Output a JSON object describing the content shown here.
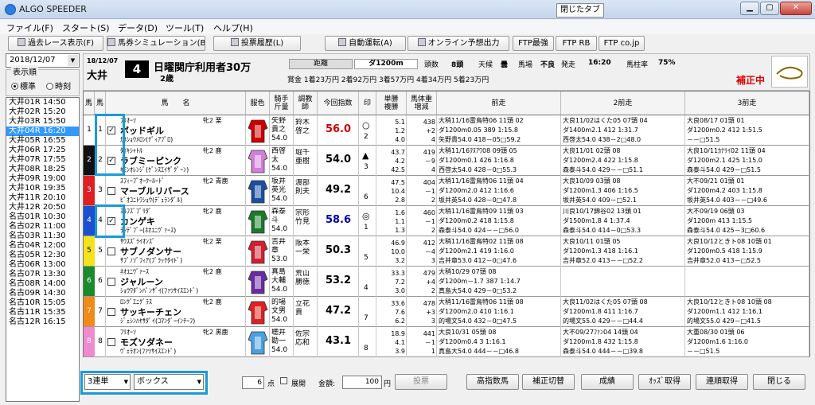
{
  "app_title": "ALGO SPEEDER",
  "closed_tab": "閉じたタブ",
  "menu": [
    "ファイル(F)",
    "スタート(S)",
    "データ(D)",
    "ツール(T)",
    "ヘルプ(H)"
  ],
  "toolbar": [
    "過去レース表示(F)",
    "馬券シミュレーション(B)",
    "投票履歴(L)",
    "自動運転(A)",
    "オンライン予想出力",
    "FTP最強",
    "FTP RB",
    "FTP co.jp"
  ],
  "date": "2018/12/07",
  "order": {
    "label": "表示順",
    "standard": "標準",
    "time": "時刻"
  },
  "races": [
    "大井01R 14:50",
    "大井02R 15:20",
    "大井03R 15:50",
    "大井04R 16:20",
    "大井05R 16:55",
    "大井06R 17:25",
    "大井07R 17:55",
    "大井08R 18:25",
    "大井09R 19:00",
    "大井10R 19:35",
    "大井11R 20:10",
    "大井12R 20:50",
    "名古01R 10:30",
    "名古02R 11:00",
    "名古03R 11:30",
    "名古04R 12:00",
    "名古05R 12:30",
    "名古06R 13:00",
    "名古07R 13:30",
    "名古08R 14:00",
    "名古09R 14:30",
    "名古10R 15:05",
    "名古11R 15:35",
    "名古12R 16:15"
  ],
  "header": {
    "date": "18/12/07",
    "venue": "大井",
    "race_no": "4",
    "race_name": "日曜関庁利用者30万",
    "age": "2歳",
    "prize": "賞金 1着23万円   2着92万円   3着57万円   4着34万円   5着23万円",
    "dist_label": "距離",
    "dist": "ダ1200m",
    "heads_label": "頭数",
    "heads": "8頭",
    "weather_label": "天候",
    "weather": "曇",
    "track_label": "馬場",
    "track": "不良",
    "post_label": "発走",
    "post": "16:20",
    "rate_label": "馬柱率",
    "rate": "75%",
    "corr": "補正中"
  },
  "columns": [
    "馬",
    "馬",
    "馬　　名",
    "服色",
    "騎手\n斤量",
    "調教\n師",
    "今回指数",
    "印",
    "単勝\n複勝",
    "馬体重\n増減",
    "前走",
    "2前走",
    "3前走"
  ],
  "horses": [
    {
      "frame": "1",
      "num": "1",
      "sire": "ﾌﾘｵｰｿ",
      "sex": "牝2 栗",
      "name": "ボッドギル",
      "dam": "ｶﾈｼｮｳﾒﾛﾝ(ﾃﾞｨｱﾌﾞﾛ)",
      "jockey": "矢野\n貴之\n54.0",
      "trainer": "鈴木\n啓之",
      "idx": "56.0",
      "idxcolor": "#cc0000",
      "mark1": "○",
      "mark2": "2",
      "win": "5.1\n1.2\n4.0",
      "wt": "438\n+2\n4",
      "p1": "大稍11/16雷鳥特06 11頭 02\nダ1200m0.05 389 1:15.8\n矢野貴54.0 418－05□59.2",
      "p2": "大良11/02はくた05 07頭 04\nダ1400m2.1 412 1:31.7\n西啓太54.0 438－2□48.0",
      "p3": "大良08/17 01頭 01\nダ1200m0.2 412 1:51.5\n－－□51.5"
    },
    {
      "frame": "2",
      "num": "2",
      "sire": "ﾀｲｷｼｬﾄﾙ",
      "sex": "牝2 鹿",
      "name": "ラブミーピンク",
      "dam": "ｷﾓﾝｵﾚﾝｼﾞ(ｹﾞﾝｽｴｲｻﾞｸﾞｰﾝ)",
      "jockey": "西啓\n太\n54.0",
      "trainer": "堀千\n亜樹",
      "idx": "54.0",
      "idxcolor": "#000",
      "mark1": "▲",
      "mark2": "3",
      "win": "43.7\n4.2\n42.5",
      "wt": "419\n－9\n4",
      "p1": "大稍11/16ｦﾇｱﾜ08 09頭 05\nダ1200m0.1 426 1:16.8\n西啓太54.0 428－0□55.3",
      "p2": "大良11/01 02頭 08\nダ1200m2.4 422 1:15.8\n森泰斗54.0 429－－□51.1",
      "p3": "大良10/11ｶﾅﾘｲ02 11頭 04\nダ1200m2.1 425 1:15.0\n森泰斗54.0 429－□51.5"
    },
    {
      "frame": "3",
      "num": "3",
      "sire": "ｽﾌｨｰﾌﾟｵｰｸｰﾙｰﾄﾞ",
      "sex": "牝2 青鹿",
      "name": "マーブルリバース",
      "dam": "ﾋﾞｵｺﾆﾄﾜｼｮｳ(ﾃﾞｭﾗﾝﾀﾞﾙ)",
      "jockey": "坂井\n英光\n54.0",
      "trainer": "渡部\n則夫",
      "idx": "49.2",
      "idxcolor": "#000",
      "mark1": "",
      "mark2": "6",
      "win": "47.5\n10.4\n2.8",
      "wt": "404\n－1\n2",
      "p1": "大稍11/16雷鳥特06 11頭 04\nダ1200m2.0 412 1:16.6\n坂井英54.0 428－0□47.8",
      "p2": "大良10/09 03頭 08\nダ1200m1.3 406 1:16.5\n坂井英54.0 409－□52.1",
      "p3": "大不09/21 01頭 01\nダ1200m4.2 403 1:15.8\n坂井英54.0 403－－□49.6"
    },
    {
      "frame": "4",
      "num": "4",
      "sire": "ﾖﾙﾌｽﾞﾌﾞﾘﾀﾞ",
      "sex": "牝2 鹿",
      "name": "カンゲキ",
      "dam": "ﾗﾝﾃﾞﾌﾞｰ(ﾈｵﾕﾆｳﾞｧｰｽ)",
      "jockey": "森泰\n斗\n54.0",
      "trainer": "宗形\n竹見",
      "idx": "58.6",
      "idxcolor": "#0000aa",
      "mark1": "◎",
      "mark2": "1",
      "win": "1.6\n1.1\n1.3",
      "wt": "460\n－1\n2",
      "p1": "大稍11/16雷鳥特09 11頭 03\nダ1200m0.2 418 1:15.8\n森泰斗54.0 424－－□56.0",
      "p2": "川良10/17錦谷02 13頭 01\nダ1500m1.8 4 1:37.4\n森泰斗54.0 414－0□53.3",
      "p3": "大不09/19 06頭 03\nダ1200m 413 1:15.5\n森泰斗54.0 425－3□60.6"
    },
    {
      "frame": "5",
      "num": "5",
      "sire": "ｻｳｽｽﾞﾗｲｵﾝｽﾞ",
      "sex": "牝2 栗",
      "name": "サブノダンサー",
      "dam": "ｻﾌﾞﾉｿﾞﾌｨｱ(ﾌﾞﾗｯｸﾀｲﾄﾞ)",
      "jockey": "吉井\n章\n53.0",
      "trainer": "阪本\n一栄",
      "idx": "50.3",
      "idxcolor": "#000",
      "mark1": "",
      "mark2": "5",
      "win": "46.9\n10.0\n3.2",
      "wt": "412\n－4\n3",
      "p1": "大稍11/16雷鳥特02 11頭 08\nダ1200m2.1 419 1:16.0\n吉井章53.0 412－0□47.6",
      "p2": "大良10/11 01頭 05\nダ1200m1.3 418 1:16.1\n吉井章52.0 413－－□52.2",
      "p3": "大良10/12ときト08 10頭 01\nダ1200m0.5 418 1:15.9\n吉井章52.0 413－□52.5"
    },
    {
      "frame": "6",
      "num": "6",
      "sire": "ﾈｵﾕﾆｳﾞｧｰｽ",
      "sex": "牝2 鹿",
      "name": "ジャルーン",
      "dam": "ｼｮｳﾜﾀﾞﾝﾊﾟﾝｻﾞｲ(ﾌｧﾂｻｲｽｴﾝﾄﾞ)",
      "jockey": "真島\n大輔\n54.0",
      "trainer": "荒山\n勝徳",
      "idx": "53.2",
      "idxcolor": "#000",
      "mark1": "",
      "mark2": "4",
      "win": "33.3\n7.2\n3.0",
      "wt": "479\n+4\n2",
      "p1": "大稍10/29 07頭 08\nダ1200m－1.7 387 1:14.7\n真島大54.0 429－0□53.2",
      "p2": "",
      "p3": ""
    },
    {
      "frame": "7",
      "num": "7",
      "sire": "ﾛﾝｸﾞｴﾆｸﾞﾗｽ",
      "sex": "牝2 鹿",
      "name": "サッキーチェン",
      "dam": "ｼﾞｪｼﾝﾊﾔｻﾀﾞｲ(ｺﾏﾝﾀﾞｰｲﾝﾁｰﾌ)",
      "jockey": "的場\n文男\n54.0",
      "trainer": "立花\n貢",
      "idx": "47.2",
      "idxcolor": "#000",
      "mark1": "",
      "mark2": "7",
      "win": "33.6\n7.6\n6.2",
      "wt": "478\n+3\n3",
      "p1": "大稍11/16雷鳥特06 11頭 08\nダ1200m2.0 410 1:16.1\n的場文54.0 432－0□47.5",
      "p2": "大良11/02はくた05 07頭 08\nダ1200m1.8 411 1:16.7\n的場文55.0 429－－□44.4",
      "p3": "大良10/12ときト08 10頭 08\nダ1200m1.1 412 1:16.1\n的場文55.0 429－□41.5"
    },
    {
      "frame": "8",
      "num": "8",
      "sire": "ﾌﾘｵｰｿ",
      "sex": "牝2 黒鹿",
      "name": "モズソダネー",
      "dam": "ｳﾞｪﾗｵﾝ(ﾌｧﾂｻｲｽｴﾝﾄﾞ)",
      "jockey": "聴井\n勘一\n54.0",
      "trainer": "佐宗\n応和",
      "idx": "43.1",
      "idxcolor": "#000",
      "mark1": "",
      "mark2": "8",
      "win": "18.9\n4.1\n3.9",
      "wt": "441\n－1\n1",
      "p1": "大良10/31 05頭 08\nダ1200m0.4 3 1:16.1\n真島大54.0 444－－□46.8",
      "p2": "大不09/27ﾌｧﾝ04 14頭 04\nダ1200m1.8 432 1:15.8\n森泰斗54.0 444－－□39.8",
      "p3": "大重08/30 01頭 06\nダ1200m1.6 1:16.0\n－－□51.5"
    }
  ],
  "frame_colors": [
    "#ffffff",
    "#111111",
    "#e02020",
    "#1a4fd0",
    "#f4e21a",
    "#1a8a2a",
    "#f08a1a",
    "#f08ad0"
  ],
  "bottom": {
    "bet_type": "3連単",
    "bet_mode": "ボックス",
    "points": "6",
    "points_unit": "点",
    "expand": "展開",
    "amount_label": "金額:",
    "amount": "100",
    "amount_unit": "円",
    "vote": "投票",
    "buttons": [
      "高指数馬",
      "補正切替",
      "成績",
      "ｵｯｽﾞ取得",
      "連順取得",
      "閉じる"
    ]
  }
}
